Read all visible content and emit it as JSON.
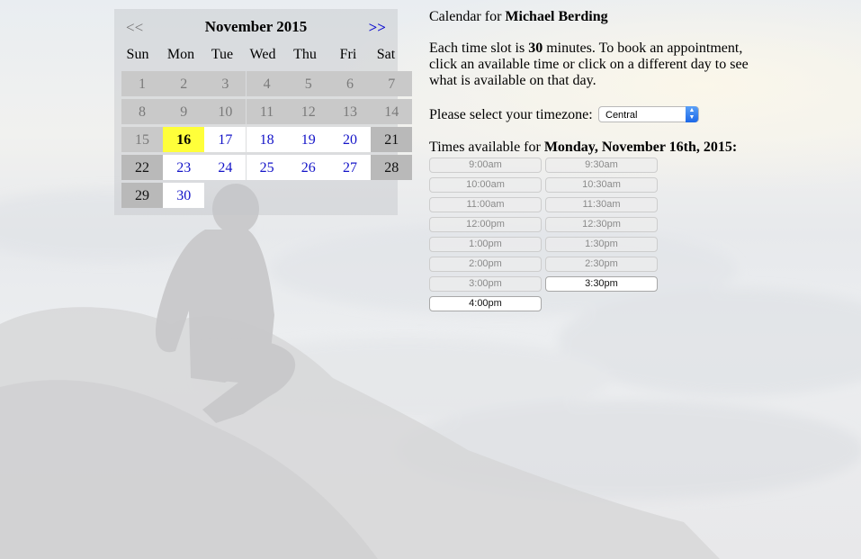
{
  "calendar": {
    "prev": "<<",
    "next": ">>",
    "month": "November 2015",
    "weekdays": [
      "Sun",
      "Mon",
      "Tue",
      "Wed",
      "Thu",
      "Fri",
      "Sat"
    ],
    "days": [
      {
        "n": "1",
        "s": "past"
      },
      {
        "n": "2",
        "s": "past"
      },
      {
        "n": "3",
        "s": "past"
      },
      {
        "n": "4",
        "s": "past"
      },
      {
        "n": "5",
        "s": "past"
      },
      {
        "n": "6",
        "s": "past"
      },
      {
        "n": "7",
        "s": "past"
      },
      {
        "n": "8",
        "s": "past"
      },
      {
        "n": "9",
        "s": "past"
      },
      {
        "n": "10",
        "s": "past"
      },
      {
        "n": "11",
        "s": "past"
      },
      {
        "n": "12",
        "s": "past"
      },
      {
        "n": "13",
        "s": "past"
      },
      {
        "n": "14",
        "s": "past"
      },
      {
        "n": "15",
        "s": "past"
      },
      {
        "n": "16",
        "s": "today"
      },
      {
        "n": "17",
        "s": "avail"
      },
      {
        "n": "18",
        "s": "avail"
      },
      {
        "n": "19",
        "s": "avail"
      },
      {
        "n": "20",
        "s": "avail"
      },
      {
        "n": "21",
        "s": "weekend"
      },
      {
        "n": "22",
        "s": "weekend"
      },
      {
        "n": "23",
        "s": "avail"
      },
      {
        "n": "24",
        "s": "avail"
      },
      {
        "n": "25",
        "s": "avail"
      },
      {
        "n": "26",
        "s": "avail"
      },
      {
        "n": "27",
        "s": "avail"
      },
      {
        "n": "28",
        "s": "weekend"
      },
      {
        "n": "29",
        "s": "weekend"
      },
      {
        "n": "30",
        "s": "avail"
      }
    ]
  },
  "panel": {
    "title_prefix": "Calendar for ",
    "title_name": "Michael Berding",
    "info_a": "Each time slot is ",
    "info_minutes": "30",
    "info_b": " minutes. To book an appointment, click an available time or click on a different day to see what is available on that day.",
    "tz_label": "Please select your timezone:",
    "tz_value": "Central",
    "times_prefix": "Times available for ",
    "times_date": "Monday, November 16th, 2015:"
  },
  "slots": [
    {
      "t": "9:00am",
      "open": false
    },
    {
      "t": "9:30am",
      "open": false
    },
    {
      "t": "10:00am",
      "open": false
    },
    {
      "t": "10:30am",
      "open": false
    },
    {
      "t": "11:00am",
      "open": false
    },
    {
      "t": "11:30am",
      "open": false
    },
    {
      "t": "12:00pm",
      "open": false
    },
    {
      "t": "12:30pm",
      "open": false
    },
    {
      "t": "1:00pm",
      "open": false
    },
    {
      "t": "1:30pm",
      "open": false
    },
    {
      "t": "2:00pm",
      "open": false
    },
    {
      "t": "2:30pm",
      "open": false
    },
    {
      "t": "3:00pm",
      "open": false
    },
    {
      "t": "3:30pm",
      "open": true
    },
    {
      "t": "4:00pm",
      "open": true
    }
  ]
}
